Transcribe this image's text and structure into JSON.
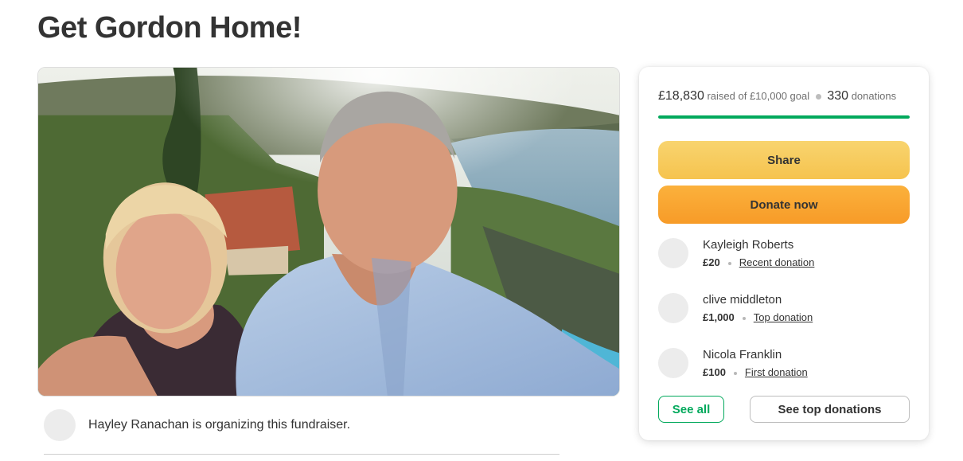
{
  "campaign": {
    "title": "Get Gordon Home!"
  },
  "hero": {
    "image_description_icon": "fundraiser-photo"
  },
  "organizer": {
    "text": "Hayley Ranachan is organizing this fundraiser."
  },
  "stats": {
    "raised": "£18,830",
    "raised_of": "raised of £10,000 goal",
    "donations_count": "330",
    "donations_label": "donations",
    "progress_fraction": 1.0
  },
  "buttons": {
    "share": "Share",
    "donate": "Donate now",
    "see_all": "See all",
    "see_top": "See top donations"
  },
  "donors": [
    {
      "name": "Kayleigh Roberts",
      "amount": "£20",
      "tag": "Recent donation"
    },
    {
      "name": "clive middleton",
      "amount": "£1,000",
      "tag": "Top donation"
    },
    {
      "name": "Nicola Franklin",
      "amount": "£100",
      "tag": "First donation"
    }
  ],
  "colors": {
    "accent_green": "#02a95c",
    "share_yellow": "#f6c34e",
    "donate_orange": "#f79b28"
  }
}
